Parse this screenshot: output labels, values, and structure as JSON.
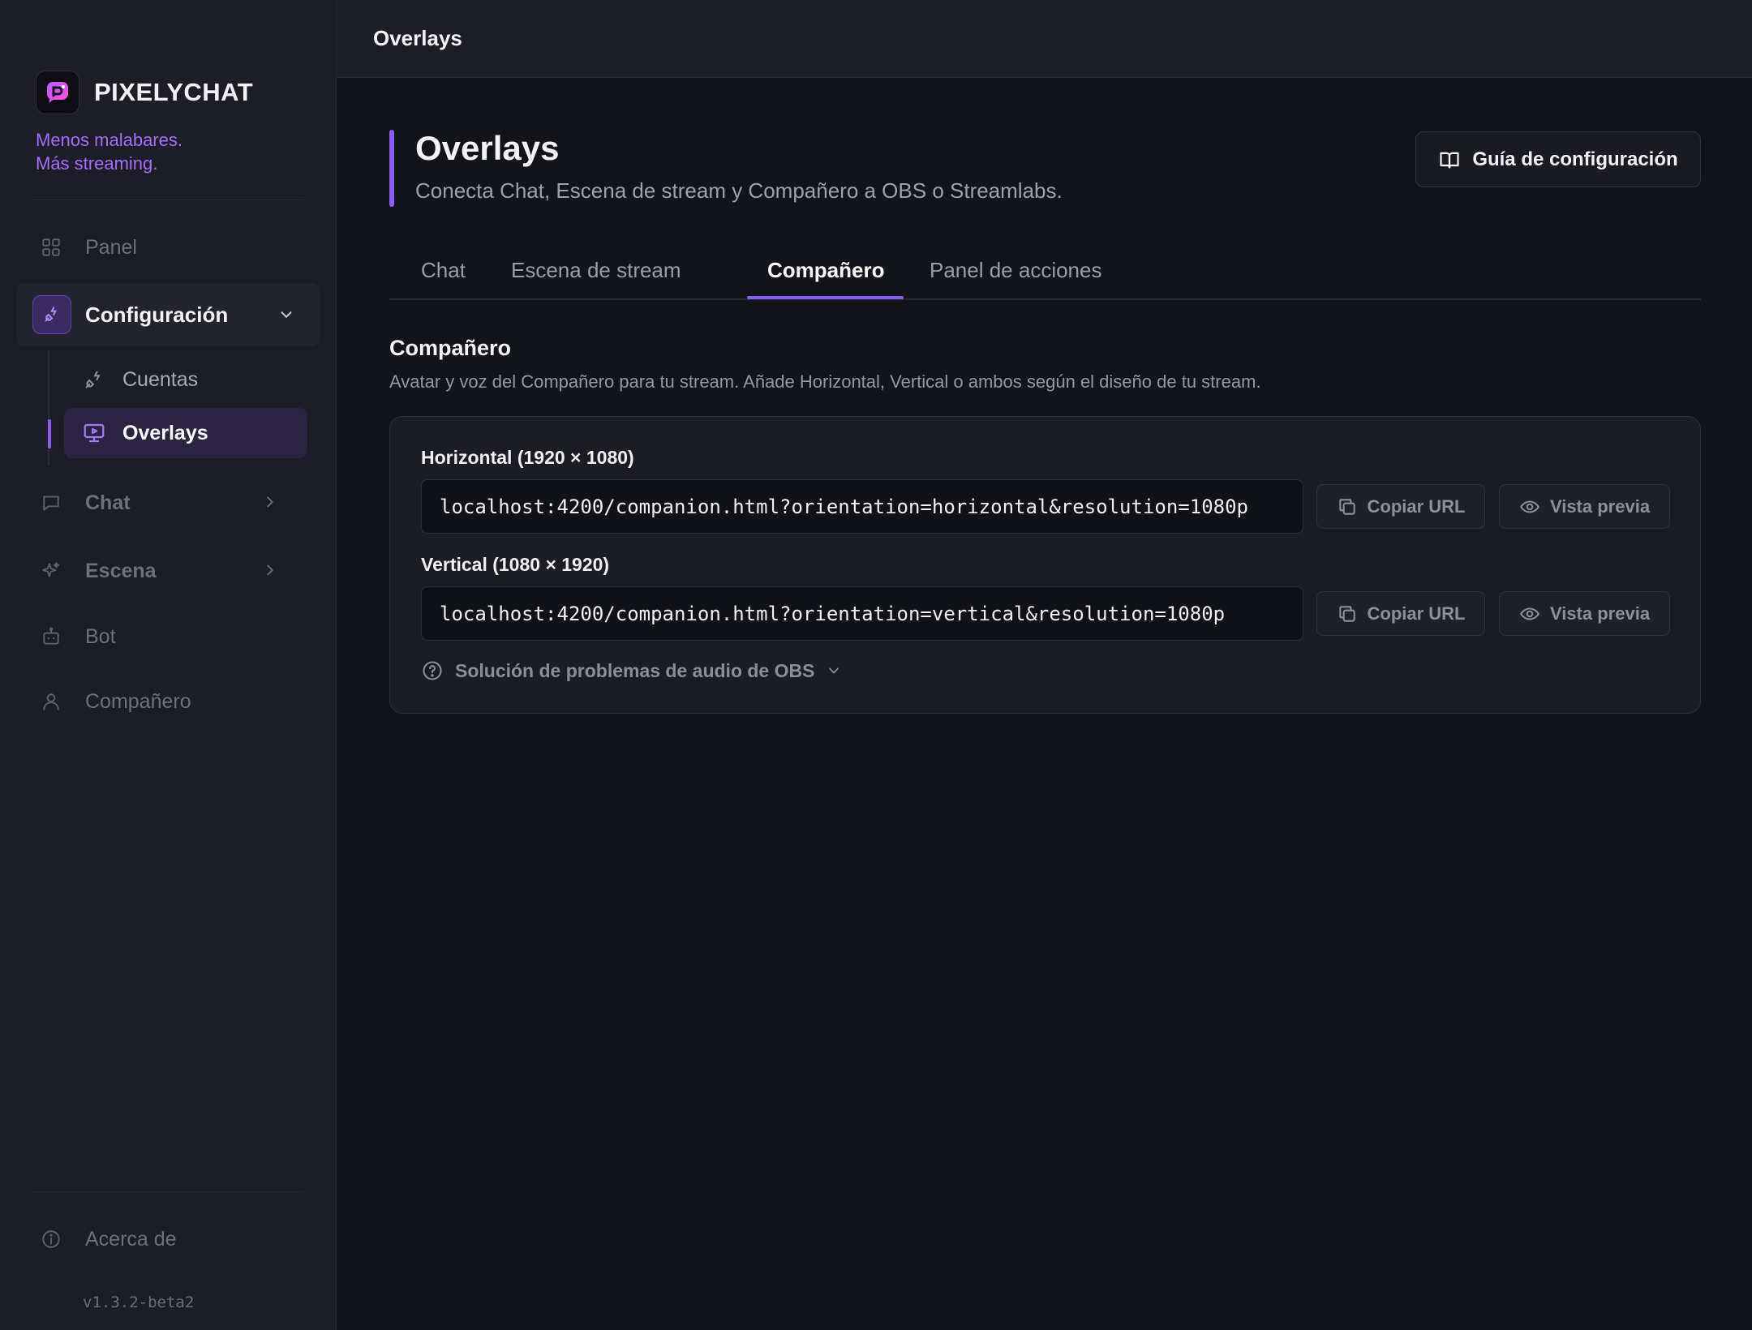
{
  "brand": {
    "name": "PIXELYCHAT",
    "tagline_line1": "Menos malabares.",
    "tagline_line2": "Más streaming."
  },
  "sidebar": {
    "panel": "Panel",
    "configuracion": "Configuración",
    "sub_items": [
      {
        "label": "Cuentas",
        "icon": "plug-icon"
      },
      {
        "label": "Overlays",
        "icon": "monitor-play-icon",
        "active": true
      }
    ],
    "chat": "Chat",
    "escena": "Escena",
    "bot": "Bot",
    "companero": "Compañero",
    "about": "Acerca de",
    "version": "v1.3.2-beta2"
  },
  "topbar": {
    "title": "Overlays"
  },
  "header": {
    "title": "Overlays",
    "subtitle": "Conecta Chat, Escena de stream y Compañero a OBS o Streamlabs.",
    "guide_button": "Guía de configuración"
  },
  "tabs": [
    {
      "label": "Chat",
      "active": false
    },
    {
      "label": "Escena de stream",
      "active": false
    },
    {
      "label": "Compañero",
      "active": true
    },
    {
      "label": "Panel de acciones",
      "active": false
    }
  ],
  "section": {
    "title": "Compañero",
    "description": "Avatar y voz del Compañero para tu stream. Añade Horizontal, Vertical o ambos según el diseño de tu stream."
  },
  "rows": [
    {
      "label": "Horizontal (1920 × 1080)",
      "url": "localhost:4200/companion.html?orientation=horizontal&resolution=1080p",
      "copy_label": "Copiar URL",
      "preview_label": "Vista previa"
    },
    {
      "label": "Vertical (1080 × 1920)",
      "url": "localhost:4200/companion.html?orientation=vertical&resolution=1080p",
      "copy_label": "Copiar URL",
      "preview_label": "Vista previa"
    }
  ],
  "troubleshoot": {
    "label": "Solución de problemas de audio de OBS"
  },
  "colors": {
    "accent": "#8b5cf6",
    "tagline": "#a56cff",
    "background": "#131419",
    "sidebar": "#1c1d26",
    "card": "#1b1c24"
  }
}
